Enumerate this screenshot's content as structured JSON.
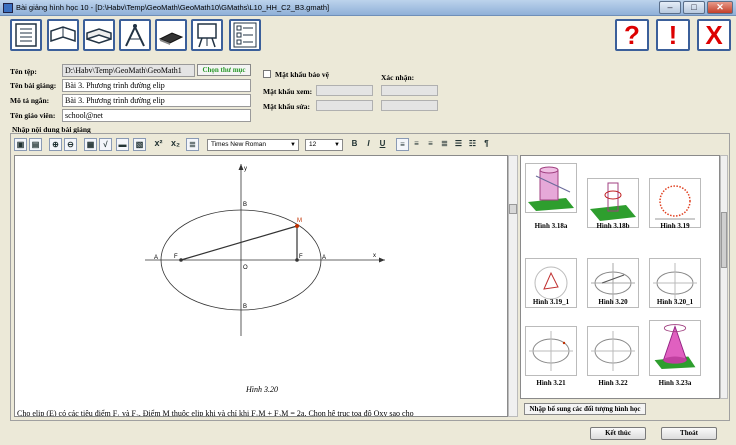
{
  "window": {
    "title": "Bài giảng hình học 10 - [D:\\Habv\\Temp\\GeoMath\\GeoMath10\\GMaths\\L10_HH_C2_B3.gmath]",
    "min": "–",
    "max": "□",
    "close": "✕"
  },
  "toolbar": {
    "help": "?",
    "warning": "!",
    "close": "X"
  },
  "form": {
    "dir_label": "Tên tệp:",
    "dir_value": "D:\\Habv\\Temp\\GeoMath\\GeoMath1",
    "choose_dir": "Chọn thư mục",
    "lesson_label": "Tên bài giảng:",
    "lesson_value": "Bài 3. Phương trình đường elip",
    "desc_label": "Mô tả ngắn:",
    "desc_value": "Bài 3. Phương trình đường elip",
    "teacher_label": "Tên giáo viên:",
    "teacher_value": "school@net",
    "protect_label": "Mật khẩu bảo vệ",
    "confirm_label": "Xác nhận:",
    "view_pw_label": "Mật khẩu xem:",
    "edit_pw_label": "Mật khẩu sửa:"
  },
  "editor": {
    "section_label": "Nhập nội dung bài giảng",
    "font": "Times New Roman",
    "size": "12",
    "bold": "B",
    "italic": "I",
    "underline": "U",
    "para": "¶",
    "sup": "x²",
    "sub": "x₂",
    "figure": {
      "caption": "Hình 3.20",
      "y": "y",
      "x": "x",
      "o": "O",
      "m": "M",
      "a1": "A",
      "a2": "A",
      "f1": "F",
      "f2": "F",
      "b1": "B",
      "b2": "B"
    },
    "bottom_text": "Cho elip (E) có các tiêu điểm F₁ và F₂. Điểm M thuộc elip khi và chỉ khi F₁M + F₂M = 2a. Chọn hệ trục tọa độ Oxy sao cho"
  },
  "gallery": {
    "items": [
      "Hình 3.18a",
      "Hình 3.18b",
      "Hình 3.19",
      "Hình 3.19_1",
      "Hình 3.20",
      "Hình 3.20_1",
      "Hình 3.21",
      "Hình 3.22",
      "Hình 3.23a"
    ],
    "add_button": "Nhập bổ sung các đối tượng hình học"
  },
  "footer": {
    "finish": "Kết thúc",
    "exit": "Thoát"
  }
}
